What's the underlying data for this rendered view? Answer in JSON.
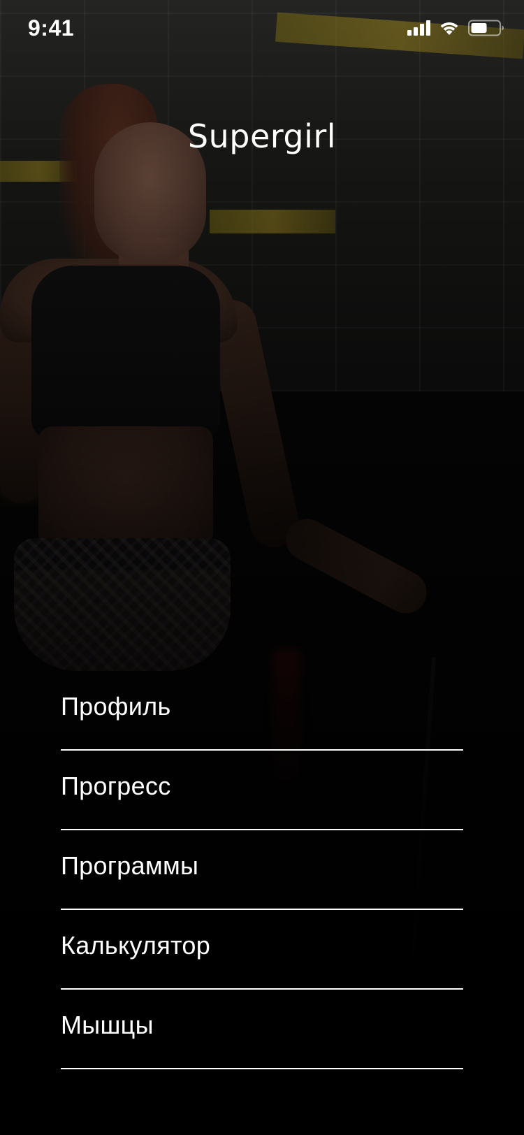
{
  "status_bar": {
    "time": "9:41",
    "icons": [
      "cellular-signal-icon",
      "wifi-icon",
      "battery-icon"
    ]
  },
  "header": {
    "title": "Supergirl"
  },
  "menu": {
    "items": [
      {
        "label": "Профиль"
      },
      {
        "label": "Прогресс"
      },
      {
        "label": "Программы"
      },
      {
        "label": "Калькулятор"
      },
      {
        "label": "Мышцы"
      }
    ]
  },
  "colors": {
    "text": "#ffffff",
    "divider": "#ffffff",
    "background": "#000000",
    "accent_background": "#b49a22"
  }
}
